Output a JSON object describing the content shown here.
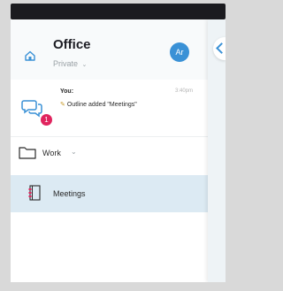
{
  "header": {
    "title": "Office",
    "subtitle": "Private",
    "subtitle_chevron": "⌄",
    "avatar_initials": "Ar"
  },
  "chat": {
    "badge_count": "1",
    "sender": "You:",
    "time": "3:40pm",
    "message": "Outline added \"Meetings\"",
    "pencil_glyph": "✎"
  },
  "folder": {
    "label": "Work",
    "chevron": "⌄"
  },
  "notebook": {
    "label": "Meetings"
  },
  "colors": {
    "accent": "#3a91d6",
    "badge": "#e0245e",
    "selected_row": "#dceaf3"
  }
}
